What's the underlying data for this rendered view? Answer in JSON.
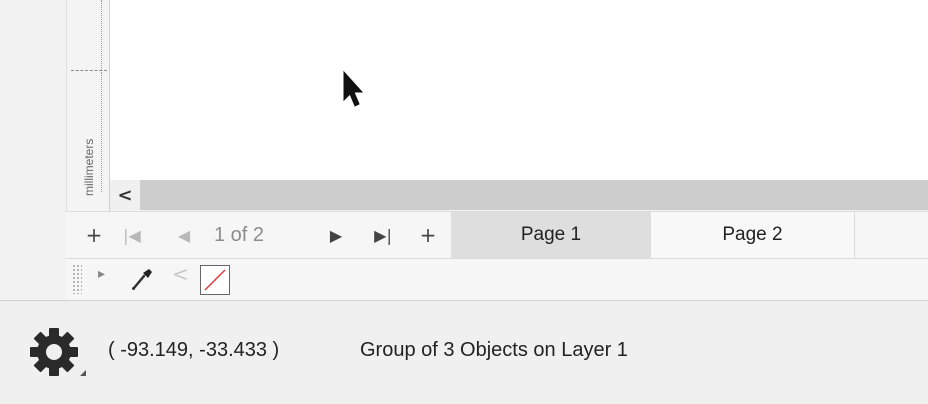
{
  "ruler": {
    "unit_label": "millimeters"
  },
  "scrollbar": {
    "left_arrow": "<"
  },
  "page_nav": {
    "add_before": "+",
    "first": "|◀",
    "prev": "◀",
    "page_counter": "1 of 2",
    "next": "▶",
    "last": "▶|",
    "add_after": "+"
  },
  "page_tabs": [
    {
      "label": "Page 1",
      "active": true
    },
    {
      "label": "Page 2",
      "active": false
    }
  ],
  "palette": {
    "expand": "▸",
    "scroll_left": "<",
    "no_fill_icon": "no-color-swatch"
  },
  "status": {
    "coordinates": "( -93.149, -33.433 )",
    "message": "Group of 3 Objects on Layer 1"
  },
  "colors": {
    "active_tab": "#dedede",
    "no_fill_line": "#e23a3a",
    "scrollbar": "#d7d7d7"
  }
}
